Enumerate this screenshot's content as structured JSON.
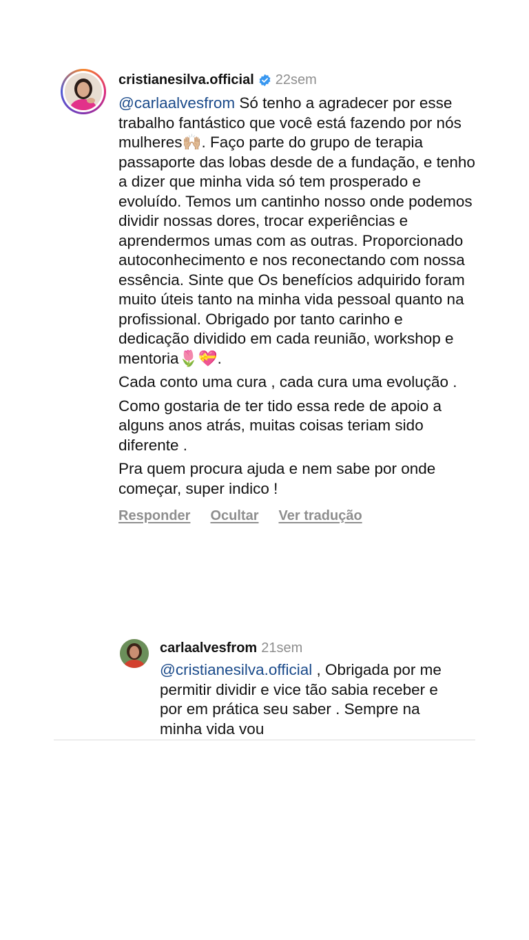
{
  "comment": {
    "username": "cristianesilva.official",
    "time": "22sem",
    "mention": "@carlaalvesfrom",
    "paragraphs": [
      " Só tenho a agradecer por esse trabalho fantástico que você está fazendo por nós mulheres🙌🏼. Faço parte do grupo de terapia passaporte das lobas desde de a fundação, e tenho a dizer que minha vida só tem prosperado e evoluído. Temos um cantinho nosso onde podemos dividir nossas dores, trocar experiências e aprendermos umas com as outras. Proporcionado autoconhecimento e nos reconectando com nossa essência. Sinte que Os benefícios  adquirido  foram muito úteis tanto na minha vida  pessoal quanto na profissional. Obrigado por tanto carinho e dedicação dividido em cada reunião, workshop e mentoria🌷💝.",
      "Cada conto uma cura , cada cura uma evolução .",
      "Como gostaria de ter tido essa rede de apoio a alguns anos atrás, muitas coisas teriam sido diferente .",
      "Pra quem procura ajuda e nem sabe por onde começar, super indico !"
    ],
    "actions": {
      "reply": "Responder",
      "hide": "Ocultar",
      "translate": "Ver tradução"
    }
  },
  "reply": {
    "username": "carlaalvesfrom",
    "time": "21sem",
    "mention": "@cristianesilva.official",
    "text": " , Obrigada por me permitir dividir e vice tão sabia receber e por em prática seu saber . Sempre na minha vida vou"
  },
  "colors": {
    "mention": "#1a4a8a",
    "muted": "#8e8e8e",
    "verified": "#3897f0"
  }
}
